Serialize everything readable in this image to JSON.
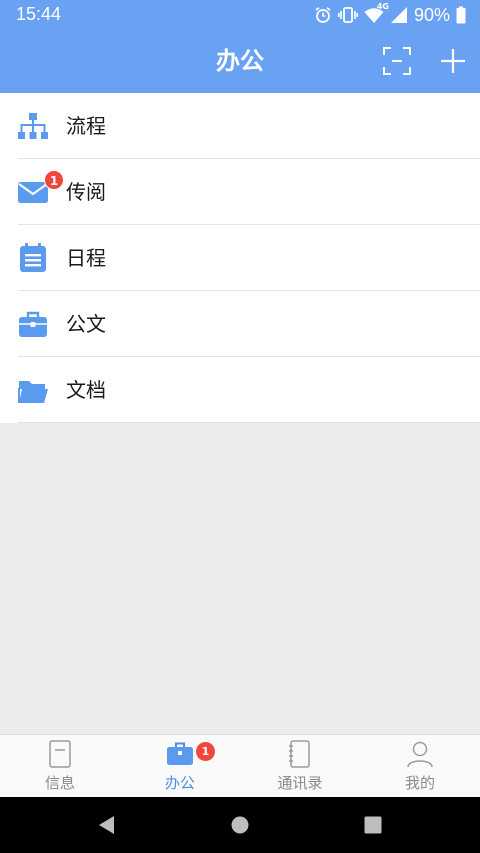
{
  "status_bar": {
    "time": "15:44",
    "network": "4G",
    "battery": "90%",
    "icons": [
      "alarm-icon",
      "vibrate-icon",
      "wifi-icon",
      "signal-icon",
      "battery-icon"
    ]
  },
  "header": {
    "title": "办公",
    "actions": [
      "scan-icon",
      "add-icon"
    ]
  },
  "menu": {
    "items": [
      {
        "label": "流程",
        "icon": "org-chart-icon"
      },
      {
        "label": "传阅",
        "icon": "mail-icon",
        "badge": "1"
      },
      {
        "label": "日程",
        "icon": "calendar-icon"
      },
      {
        "label": "公文",
        "icon": "briefcase-icon"
      },
      {
        "label": "文档",
        "icon": "folder-icon"
      }
    ]
  },
  "tabs": {
    "active": "办公",
    "items": [
      {
        "label": "信息",
        "icon": "message-doc-icon"
      },
      {
        "label": "办公",
        "icon": "briefcase-icon",
        "badge": "1"
      },
      {
        "label": "通讯录",
        "icon": "address-book-icon"
      },
      {
        "label": "我的",
        "icon": "person-icon"
      }
    ]
  },
  "colors": {
    "accent": "#6aa2f3",
    "icon_blue": "#5b9bef",
    "badge_red": "#f2463c",
    "active_tab": "#4d8fe8"
  },
  "nav_bar": {
    "buttons": [
      "back-icon",
      "home-icon",
      "recents-icon"
    ]
  }
}
